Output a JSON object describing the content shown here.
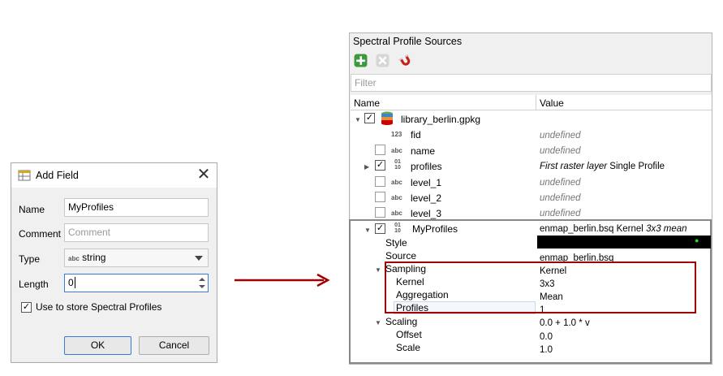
{
  "dialog": {
    "title": "Add Field",
    "fields": {
      "name_label": "Name",
      "name_value": "MyProfiles",
      "comment_label": "Comment",
      "comment_placeholder": "Comment",
      "type_label": "Type",
      "type_icon": "abc",
      "type_value": "string",
      "length_label": "Length",
      "length_value": "0"
    },
    "checkbox_label": "Use to store Spectral Profiles",
    "ok_label": "OK",
    "cancel_label": "Cancel"
  },
  "arrow_color": "#a00000",
  "panel": {
    "title": "Spectral Profile Sources",
    "filter_placeholder": "Filter",
    "columns": {
      "name": "Name",
      "value": "Value"
    },
    "library": "library_berlin.gpkg",
    "fields": [
      {
        "name": "fid",
        "icon": "123",
        "value": "undefined"
      },
      {
        "name": "name",
        "icon": "abc",
        "value": "undefined"
      },
      {
        "name": "profiles",
        "icon": "01 10",
        "value_italic": "First raster layer",
        "value_plain": "Single Profile"
      },
      {
        "name": "level_1",
        "icon": "abc",
        "value": "undefined"
      },
      {
        "name": "level_2",
        "icon": "abc",
        "value": "undefined"
      },
      {
        "name": "level_3",
        "icon": "abc",
        "value": "undefined"
      }
    ],
    "myprofiles": {
      "name": "MyProfiles",
      "icon": "01 10",
      "value_plain": "enmap_berlin.bsq Kernel",
      "value_italic": "3x3 mean",
      "style_label": "Style",
      "source_label": "Source",
      "source_value": "enmap_berlin.bsq",
      "sampling_label": "Sampling",
      "sampling_value": "Kernel",
      "kernel_label": "Kernel",
      "kernel_value": "3x3",
      "aggregation_label": "Aggregation",
      "aggregation_value": "Mean",
      "profiles_label": "Profiles",
      "profiles_value": "1",
      "scaling_label": "Scaling",
      "scaling_value": "0.0 + 1.0 * v",
      "offset_label": "Offset",
      "offset_value": "0.0",
      "scale_label": "Scale",
      "scale_value": "1.0"
    }
  }
}
